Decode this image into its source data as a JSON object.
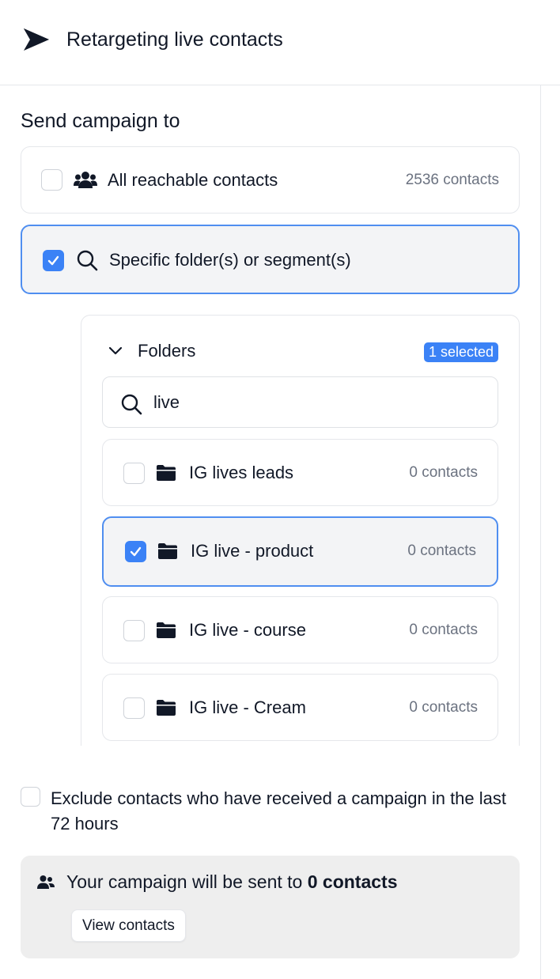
{
  "header": {
    "title": "Retargeting live contacts",
    "logo_icon": "send-arrow-logo"
  },
  "audience": {
    "section_title": "Send campaign to",
    "options": [
      {
        "label": "All reachable contacts",
        "count": "2536 contacts",
        "checked": false,
        "icon": "users-icon"
      },
      {
        "label": "Specific folder(s) or segment(s)",
        "checked": true,
        "icon": "search-icon"
      }
    ]
  },
  "folders": {
    "title": "Folders",
    "selected_badge": "1 selected",
    "search_value": "live",
    "items": [
      {
        "name": "IG lives leads",
        "count": "0 contacts",
        "checked": false
      },
      {
        "name": "IG live - product",
        "count": "0 contacts",
        "checked": true
      },
      {
        "name": "IG live - course",
        "count": "0 contacts",
        "checked": false
      },
      {
        "name": "IG live - Cream",
        "count": "0 contacts",
        "checked": false
      }
    ]
  },
  "exclude": {
    "label": "Exclude contacts who have received a campaign in the last 72 hours",
    "checked": false
  },
  "summary": {
    "prefix": "Your campaign will be sent to",
    "count_text": "0 contacts",
    "button_label": "View contacts"
  },
  "colors": {
    "accent": "#3b82f6",
    "selected_border": "#4f8ef0",
    "muted": "#6b7280"
  }
}
